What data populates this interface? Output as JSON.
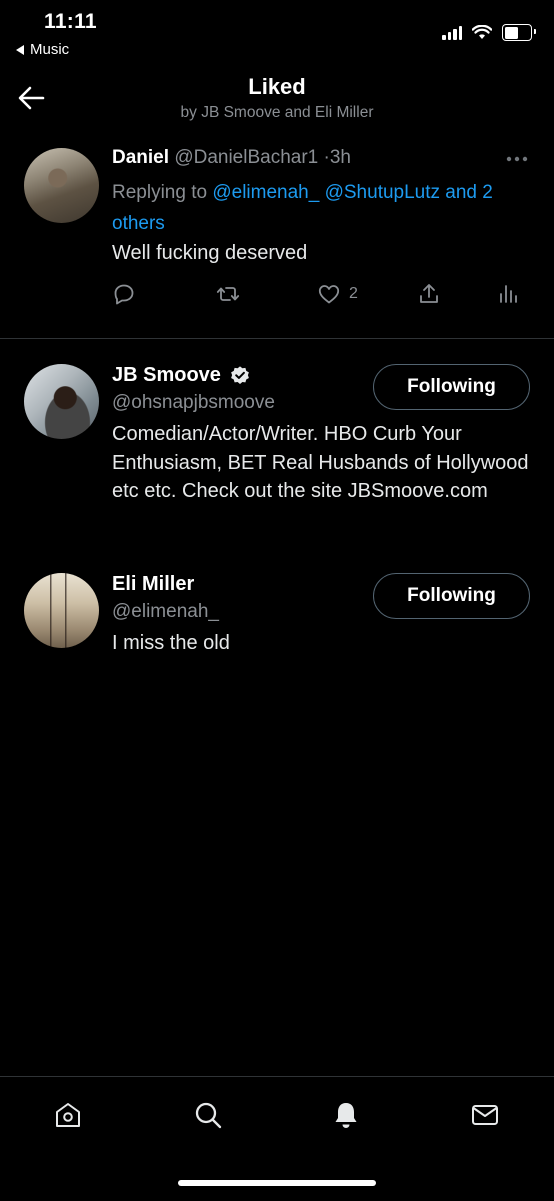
{
  "status_bar": {
    "time": "11:11",
    "back_app": "Music",
    "battery_level": 0.55
  },
  "header": {
    "title": "Liked",
    "subtitle": "by JB Smoove and Eli Miller"
  },
  "tweet": {
    "display_name": "Daniel",
    "handle": "@DanielBachar1",
    "separator": "·",
    "time": "3h",
    "replying_prefix": "Replying to ",
    "mention1": "@elimenah_",
    "mention2": "@ShutupLutz",
    "mention_suffix": "and 2 others",
    "text": "Well fucking deserved",
    "like_count": "2"
  },
  "users": [
    {
      "display_name": "JB Smoove",
      "handle": "@ohsnapjbsmoove",
      "bio": "Comedian/Actor/Writer. HBO Curb Your Enthusiasm, BET Real Husbands of Hollywood etc etc. Check out the site JBSmoove.com",
      "follow_label": "Following",
      "verified": true
    },
    {
      "display_name": "Eli Miller",
      "handle": "@elimenah_",
      "bio": "I miss the old",
      "follow_label": "Following",
      "verified": false
    }
  ],
  "colors": {
    "background": "#000000",
    "link": "#1d9bf0",
    "secondary_text": "#8b8f94",
    "divider": "#2f3336"
  },
  "tab_bar": [
    "home-icon",
    "search-icon",
    "notifications-icon",
    "messages-icon"
  ]
}
